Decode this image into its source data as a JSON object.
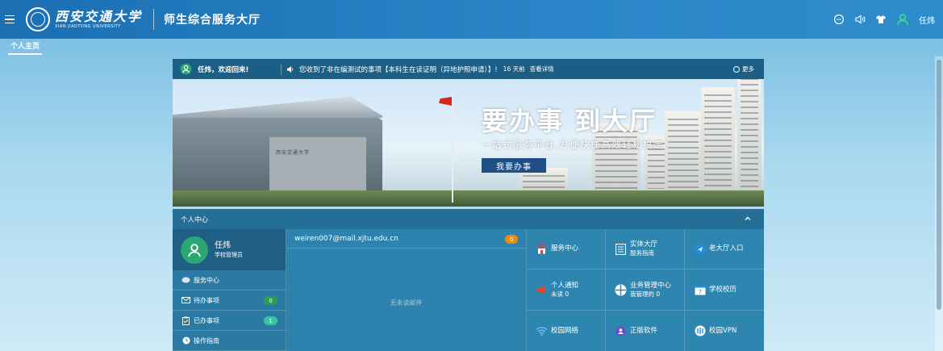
{
  "header": {
    "logo_cn": "西安交通大学",
    "logo_en": "XIAN JIAOTONG UNIVERSITY",
    "app_title": "师生综合服务大厅",
    "user_name": "任炜",
    "icons": [
      "chat-icon",
      "volume-icon",
      "shirt-icon",
      "user-icon"
    ]
  },
  "tabs": [
    {
      "label": "个人主页",
      "active": true
    }
  ],
  "notice_bar": {
    "welcome": "任炜，欢迎回来!",
    "notice_text": "您收到了非在编测试的事项【本科生在读证明（异地护照申请）】!",
    "days": "16 天前",
    "detail": "查看详情",
    "more": "更多"
  },
  "banner": {
    "slogan": "要办事 到大厅",
    "subslogan": "一站式服务平台,方便快捷高效轻松搞定",
    "button": "我要办事",
    "building_text": "西安交通大学"
  },
  "personal_center": {
    "title": "个人中心",
    "user": {
      "name": "任炜",
      "role": "学校管理员"
    },
    "menu": [
      {
        "label": "服务中心",
        "icon": "chat-bubble-icon",
        "badge": null
      },
      {
        "label": "待办事项",
        "icon": "mail-icon",
        "badge": "0"
      },
      {
        "label": "已办事项",
        "icon": "clipboard-icon",
        "badge": "1"
      },
      {
        "label": "操作指南",
        "icon": "clock-icon",
        "badge": null
      }
    ],
    "mail": {
      "address": "weiren007@mail.xjtu.edu.cn",
      "count": "0",
      "empty": "无未读邮件"
    },
    "tiles": [
      {
        "label": "服务中心",
        "sub": "",
        "icon": "house-icon"
      },
      {
        "label": "实体大厅",
        "sub": "服务指南",
        "icon": "building-icon"
      },
      {
        "label": "老大厅入口",
        "sub": "",
        "icon": "send-icon"
      },
      {
        "label": "个人通知",
        "sub": "未读 0",
        "icon": "megaphone-icon"
      },
      {
        "label": "业务管理中心",
        "sub": "我管理的 0",
        "icon": "grid-icon"
      },
      {
        "label": "学校校历",
        "sub": "",
        "icon": "calendar-icon"
      },
      {
        "label": "校园网络",
        "sub": "",
        "icon": "wifi-icon"
      },
      {
        "label": "正版软件",
        "sub": "",
        "icon": "user-circle-icon"
      },
      {
        "label": "校园VPN",
        "sub": "",
        "icon": "vpn-icon"
      }
    ]
  },
  "colors": {
    "header": "#2a86c8",
    "notice_bar": "#1c5f86",
    "panel": "#2d83ad",
    "avatar_green": "#2aa772",
    "badge_green": "#25a24b",
    "badge_orange": "#f08a00"
  }
}
